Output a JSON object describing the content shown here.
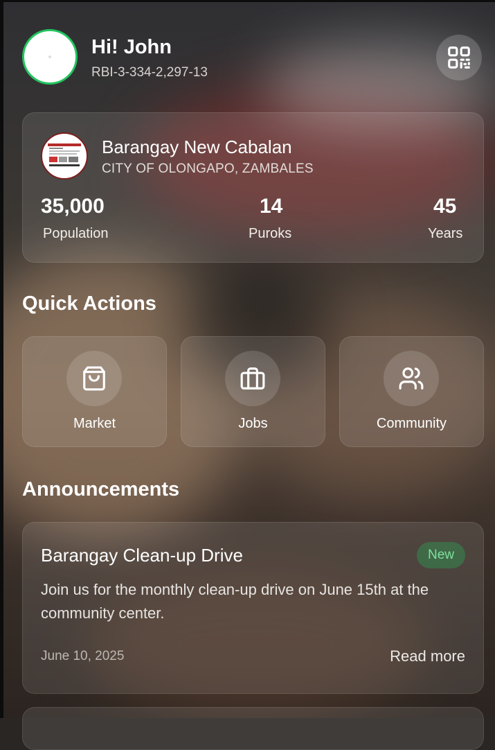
{
  "header": {
    "greeting": "Hi! John",
    "user_id": "RBI-3-334-2,297-13",
    "qr_icon": "qr-code-icon"
  },
  "barangay": {
    "name": "Barangay New Cabalan",
    "location": "CITY OF OLONGAPO, ZAMBALES",
    "stats": [
      {
        "value": "35,000",
        "label": "Population"
      },
      {
        "value": "14",
        "label": "Puroks"
      },
      {
        "value": "45",
        "label": "Years"
      }
    ]
  },
  "quick_actions": {
    "title": "Quick Actions",
    "items": [
      {
        "label": "Market",
        "icon": "shopping-bag-icon"
      },
      {
        "label": "Jobs",
        "icon": "briefcase-icon"
      },
      {
        "label": "Community",
        "icon": "users-icon"
      }
    ]
  },
  "announcements": {
    "title": "Announcements",
    "items": [
      {
        "title": "Barangay Clean-up Drive",
        "badge": "New",
        "body": "Join us for the monthly clean-up drive on June 15th at the community center.",
        "date": "June 10, 2025",
        "action": "Read more"
      }
    ]
  },
  "colors": {
    "avatar_ring": "#22c55e",
    "badge_text": "#7fe0a0",
    "logo_ring": "#7a1f1f"
  }
}
